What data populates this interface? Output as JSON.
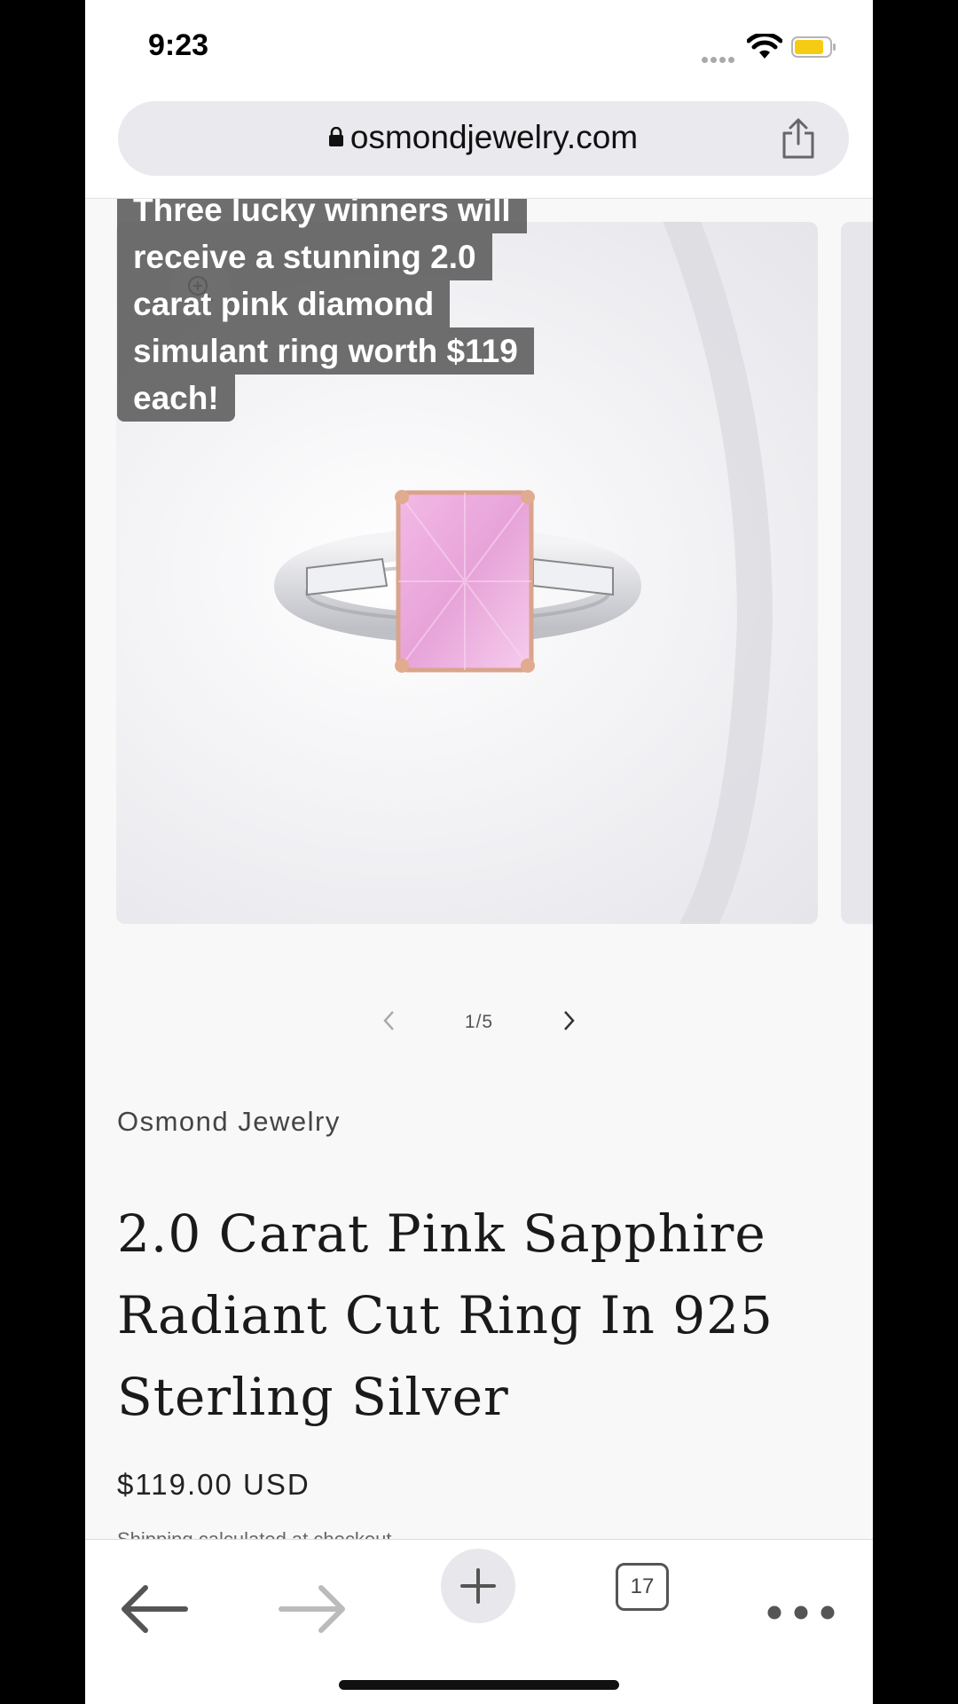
{
  "status_bar": {
    "time": "9:23",
    "battery_color": "#f5cc12"
  },
  "browser": {
    "url": "osmondjewelry.com",
    "tab_count": "17"
  },
  "caption": {
    "lines": [
      "Three lucky winners will",
      "receive a stunning 2.0",
      "carat pink diamond",
      "simulant ring worth $119",
      "each!"
    ]
  },
  "product": {
    "gallery": {
      "position": "1/5"
    },
    "vendor": "Osmond Jewelry",
    "title": "2.0 Carat Pink Sapphire Radiant Cut Ring In 925 Sterling Silver",
    "price": "$119.00 USD",
    "shipping_note": "Shipping calculated at checkout."
  },
  "icons": {
    "lock": "lock-icon",
    "share": "share-icon",
    "zoom": "zoom-in-icon",
    "back": "arrow-left-icon",
    "forward": "arrow-right-icon",
    "new_tab": "plus-icon",
    "more": "ellipsis-icon"
  }
}
